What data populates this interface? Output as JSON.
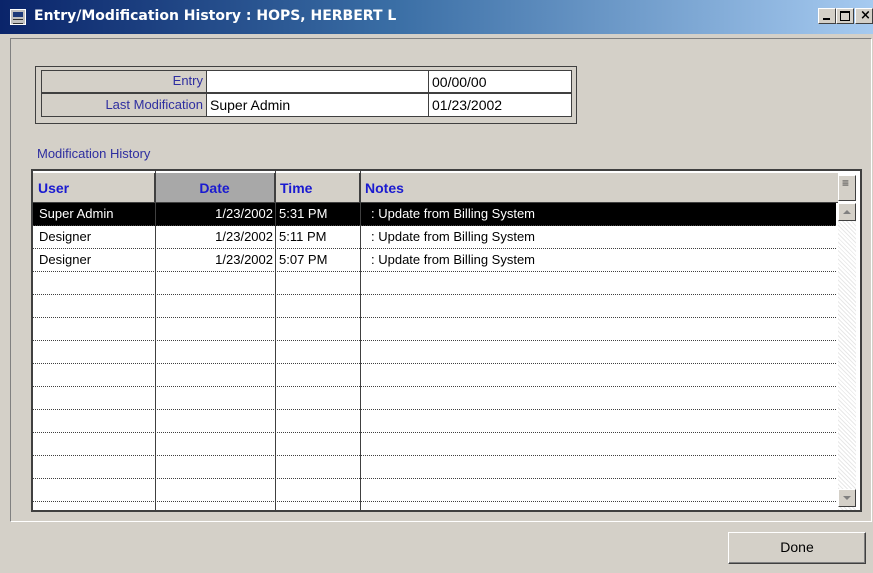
{
  "window": {
    "title": "Entry/Modification History : HOPS, HERBERT L"
  },
  "info": {
    "entry_label": "Entry",
    "entry_user": "",
    "entry_date": "00/00/00",
    "lastmod_label": "Last Modification",
    "lastmod_user": "Super Admin",
    "lastmod_date": "01/23/2002"
  },
  "history": {
    "section_label": "Modification History",
    "columns": [
      "User",
      "Date",
      "Time",
      "Notes"
    ],
    "rows": [
      {
        "user": "Super Admin",
        "date": "1/23/2002",
        "time": "5:31 PM",
        "notes": ": Update from Billing System",
        "selected": true
      },
      {
        "user": "Designer",
        "date": "1/23/2002",
        "time": "5:11 PM",
        "notes": ": Update from Billing System"
      },
      {
        "user": "Designer",
        "date": "1/23/2002",
        "time": "5:07 PM",
        "notes": ": Update from Billing System"
      }
    ]
  },
  "buttons": {
    "done": "Done"
  }
}
